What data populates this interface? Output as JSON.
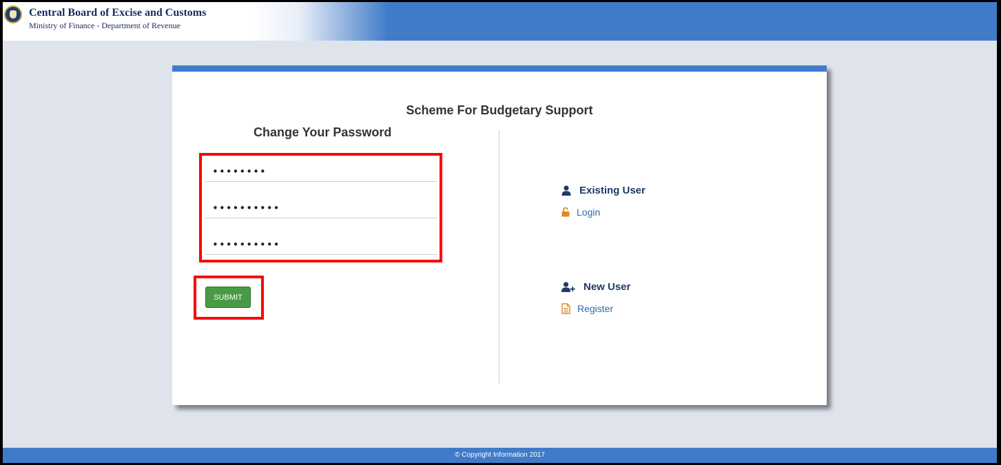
{
  "header": {
    "title": "Central Board of Excise and Customs",
    "subtitle": "Ministry of Finance - Department of Revenue"
  },
  "card": {
    "title": "Scheme For Budgetary Support"
  },
  "change_password": {
    "title": "Change Your Password",
    "fields": [
      {
        "value": "12345678"
      },
      {
        "value": "1234567890"
      },
      {
        "value": "1234567890"
      }
    ],
    "submit_label": "SUBMIT"
  },
  "existing_user": {
    "heading": "Existing User",
    "link": "Login"
  },
  "new_user": {
    "heading": "New User",
    "link": "Register"
  },
  "footer": {
    "copyright": "© Copyright Information 2017"
  },
  "colors": {
    "brand_blue": "#3f7bc8",
    "submit_green": "#4a9a45",
    "link_blue": "#2e6aa7",
    "icon_orange": "#e08a1e",
    "highlight_red": "#ff0000"
  },
  "icons": {
    "emblem": "emblem-icon",
    "existing_user": "user-icon",
    "login": "unlock-icon",
    "new_user": "user-plus-icon",
    "register": "document-icon"
  }
}
